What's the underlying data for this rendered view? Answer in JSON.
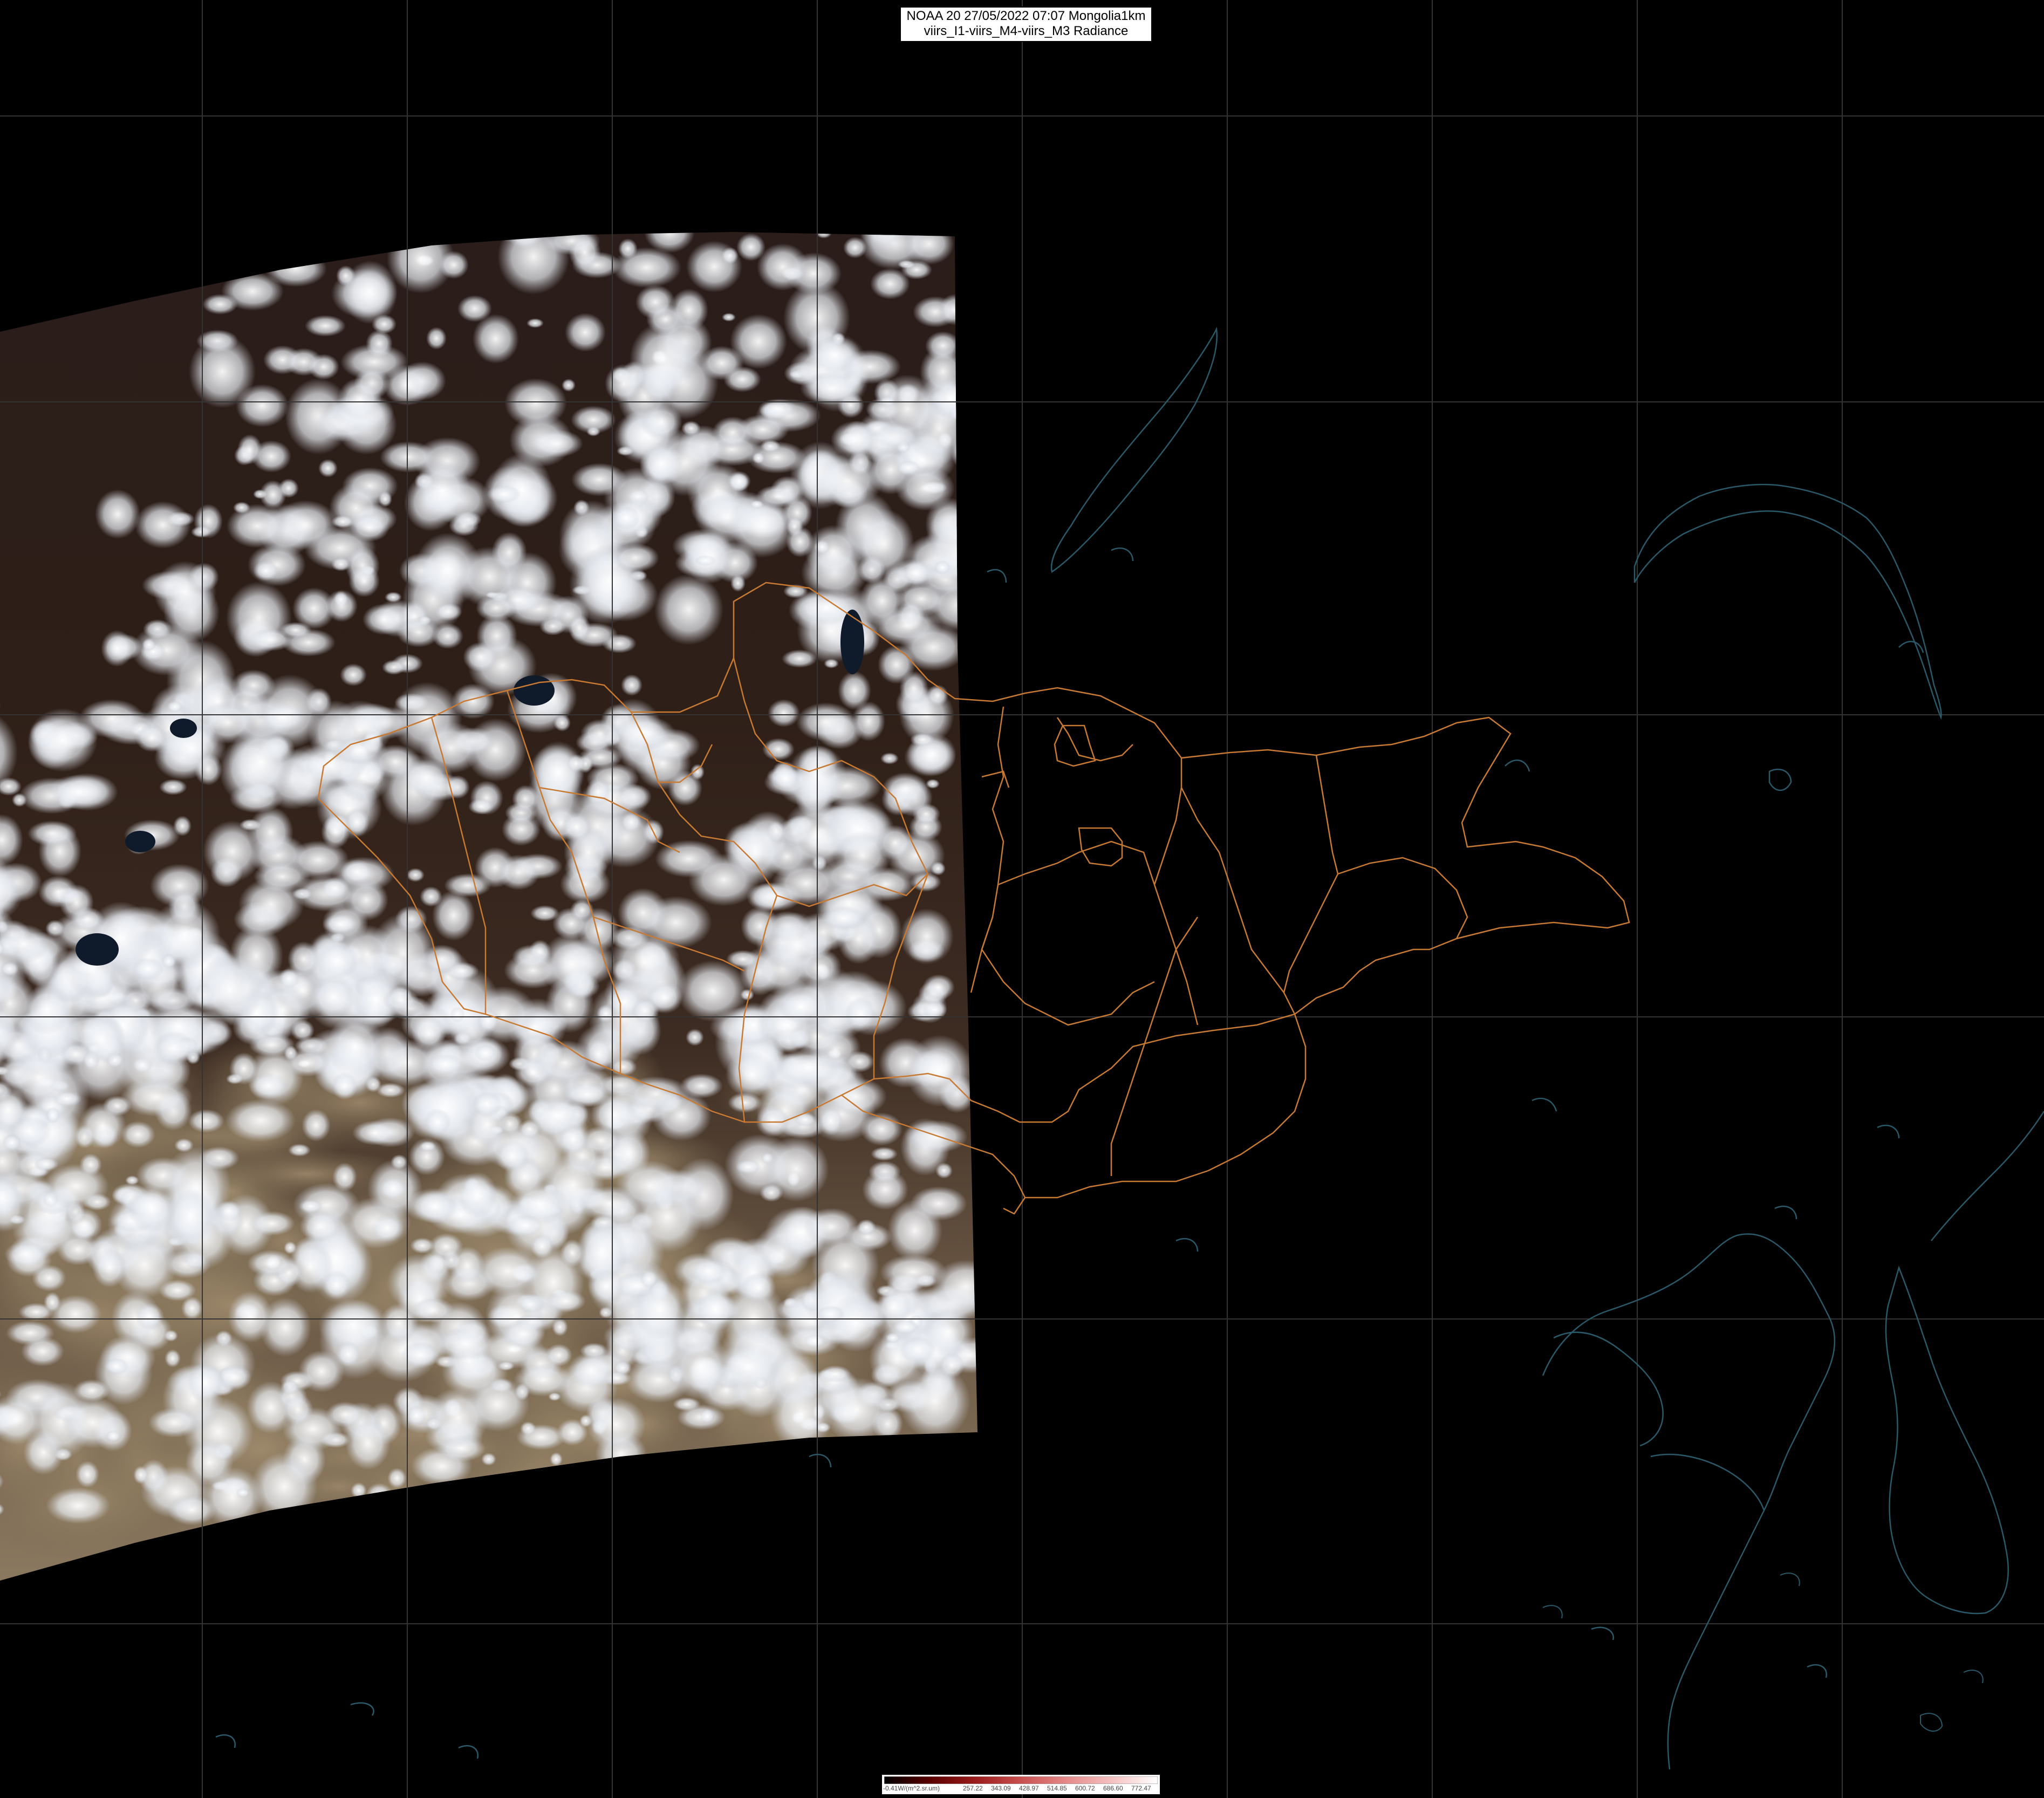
{
  "title": {
    "line1": "NOAA 20 27/05/2022 07:07 Mongolia1km",
    "line2": "viirs_I1-viirs_M4-viirs_M3 Radiance"
  },
  "legend": {
    "unit_label": "-0.41W/(m^2.sr.um)",
    "ticks": [
      "257.22",
      "343.09",
      "428.97",
      "514.85",
      "600.72",
      "686.60",
      "772.47"
    ],
    "gradient": [
      "#000000",
      "#5a0000",
      "#9b1b1b",
      "#c95050",
      "#e58a8a",
      "#f5c1c1",
      "#ffffff"
    ]
  },
  "colors": {
    "background": "#000000",
    "graticule": "#333333",
    "borders": "#c87a32",
    "coastline": "#2a5a6a",
    "cloud": "#f4f6fa",
    "land_dark": "#2a1a14",
    "desert": "#8a7a62"
  }
}
